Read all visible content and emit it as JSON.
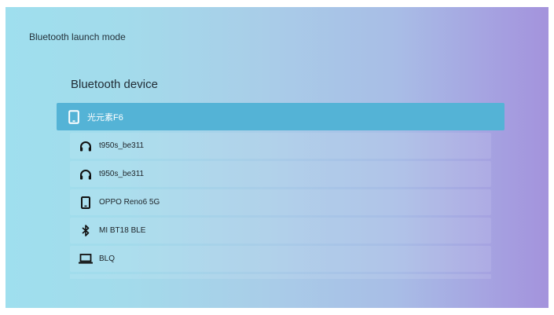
{
  "header": {
    "mode_title": "Bluetooth launch mode",
    "section_title": "Bluetooth device"
  },
  "devices": [
    {
      "label": "光元素F6",
      "icon": "phone-icon",
      "selected": true
    },
    {
      "label": "t950s_be311",
      "icon": "headphones-icon",
      "selected": false
    },
    {
      "label": "t950s_be311",
      "icon": "headphones-icon",
      "selected": false
    },
    {
      "label": "OPPO Reno6 5G",
      "icon": "phone-icon",
      "selected": false
    },
    {
      "label": "MI BT18 BLE",
      "icon": "bluetooth-icon",
      "selected": false
    },
    {
      "label": "BLQ",
      "icon": "laptop-icon",
      "selected": false
    }
  ],
  "colors": {
    "selected_row": "#54b3d6",
    "gradient_left": "#9fdfee",
    "gradient_right": "#a493dc"
  }
}
